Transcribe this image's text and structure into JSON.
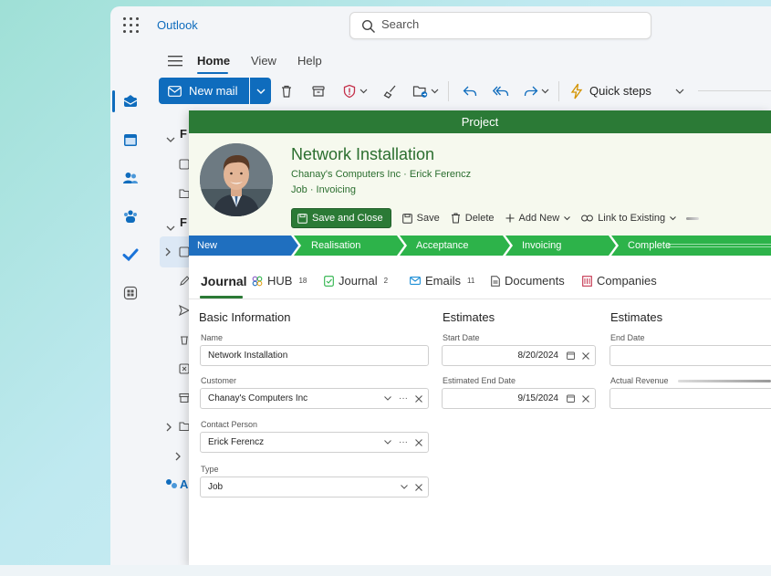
{
  "app": {
    "name": "Outlook"
  },
  "search": {
    "placeholder": "Search"
  },
  "ribbon": {
    "tabs": [
      {
        "label": "Home",
        "active": true
      },
      {
        "label": "View",
        "active": false
      },
      {
        "label": "Help",
        "active": false
      }
    ],
    "new_mail": "New mail",
    "quick_steps": "Quick steps"
  },
  "folders": {
    "items": [
      "F",
      "F"
    ],
    "bottom": "A"
  },
  "project": {
    "window_title": "Project",
    "name": "Network Installation",
    "company": "Chanay's Computers Inc",
    "contact": "Erick Ferencz",
    "type": "Job",
    "stage_current": "Invoicing",
    "actions": {
      "save_close": "Save and Close",
      "save": "Save",
      "delete": "Delete",
      "add_new": "Add New",
      "link_existing": "Link to Existing"
    },
    "stages": [
      "New",
      "Realisation",
      "Acceptance",
      "Invoicing",
      "Complete"
    ],
    "tabs": [
      {
        "label": "Journal",
        "badge": ""
      },
      {
        "label": "HUB",
        "badge": "18"
      },
      {
        "label": "Journal",
        "badge": "2"
      },
      {
        "label": "Emails",
        "badge": "11"
      },
      {
        "label": "Documents",
        "badge": ""
      },
      {
        "label": "Companies",
        "badge": ""
      }
    ],
    "basic": {
      "title": "Basic Information",
      "name_label": "Name",
      "name_value": "Network Installation",
      "customer_label": "Customer",
      "customer_value": "Chanay's Computers Inc",
      "contact_label": "Contact Person",
      "contact_value": "Erick Ferencz",
      "type_label": "Type",
      "type_value": "Job"
    },
    "estimates1": {
      "title": "Estimates",
      "start_label": "Start Date",
      "start_value": "8/20/2024",
      "end_label": "Estimated End Date",
      "end_value": "9/15/2024"
    },
    "estimates2": {
      "title": "Estimates",
      "end_label": "End Date",
      "revenue_label": "Actual Revenue"
    }
  },
  "colors": {
    "outlook_blue": "#0f6cbd",
    "project_green": "#2b7a36",
    "stage_blue": "#1f6fbf",
    "stage_green": "#2db34a"
  }
}
